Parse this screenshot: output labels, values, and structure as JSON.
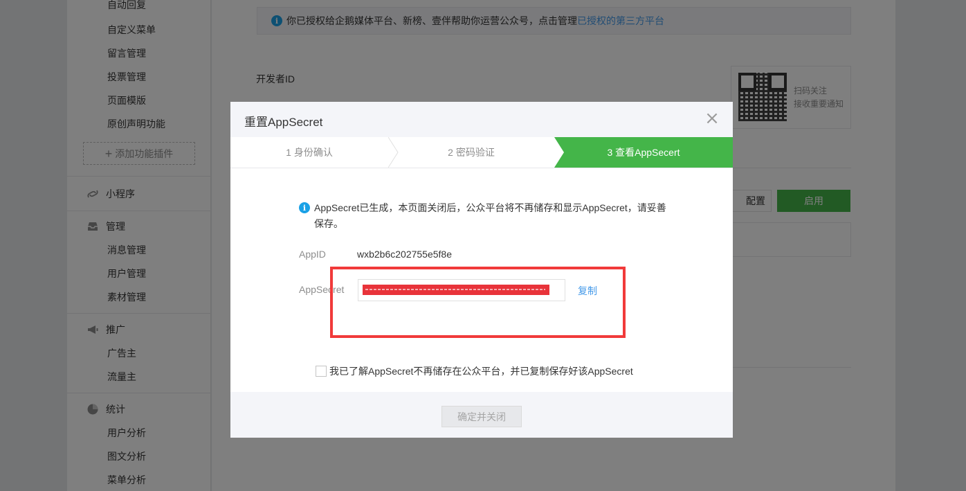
{
  "sidebar": {
    "group_top_items": [
      "自动回复",
      "自定义菜单",
      "留言管理",
      "投票管理",
      "页面模版",
      "原创声明功能"
    ],
    "add_plugin_label": "添加功能插件",
    "miniprogram_label": "小程序",
    "manage": {
      "label": "管理",
      "items": [
        "消息管理",
        "用户管理",
        "素材管理"
      ]
    },
    "promote": {
      "label": "推广",
      "items": [
        "广告主",
        "流量主"
      ]
    },
    "stats": {
      "label": "统计",
      "items": [
        "用户分析",
        "图文分析",
        "菜单分析"
      ]
    }
  },
  "content": {
    "notice_text": "你已授权给企鹅媒体平台、新榜、壹伴帮助你运营公众号，点击管理",
    "notice_link": "已授权的第三方平台",
    "developer_id_label": "开发者ID",
    "qr_caption_line1": "扫码关注",
    "qr_caption_line2": "接收重要通知",
    "config_button": "配置",
    "enable_button": "启用"
  },
  "dialog": {
    "title": "重置AppSecret",
    "close_glyph": "×",
    "steps": [
      {
        "label": "1 身份确认",
        "active": false
      },
      {
        "label": "2 密码验证",
        "active": false
      },
      {
        "label": "3 查看AppSecert",
        "active": true
      }
    ],
    "tip": "AppSecret已生成，本页面关闭后，公众平台将不再储存和显示AppSecret，请妥善保存。",
    "appid_label": "AppID",
    "appid_value": "wxb2b6c202755e5f8e",
    "appsecret_label": "AppSecret",
    "copy_label": "复制",
    "agree_text": "我已了解AppSecret不再储存在公众平台，并已复制保存好该AppSecret",
    "agree_checked": false,
    "confirm_button": "确定并关闭"
  },
  "colors": {
    "accent_green": "#44b549",
    "link_blue": "#459ae9",
    "info_blue": "#1aa1e6",
    "annotation_red": "#f13a3a",
    "redaction_red": "#e8333a"
  }
}
